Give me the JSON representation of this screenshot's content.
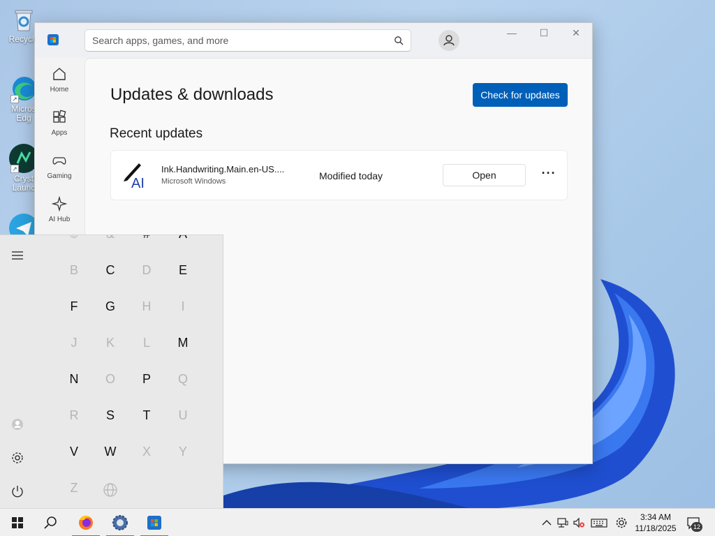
{
  "desktop": {
    "icons": [
      {
        "label": "Recycle",
        "icon": "recycle-bin-icon"
      },
      {
        "label": "Micros Edg",
        "icon": "edge-icon"
      },
      {
        "label": "Cryst Launc",
        "icon": "crystal-launcher-icon"
      },
      {
        "label": "",
        "icon": "telegram-icon"
      }
    ]
  },
  "store": {
    "search_placeholder": "Search apps, games, and more",
    "nav": [
      {
        "label": "Home",
        "icon": "home-icon"
      },
      {
        "label": "Apps",
        "icon": "apps-icon"
      },
      {
        "label": "Gaming",
        "icon": "gaming-icon"
      },
      {
        "label": "AI Hub",
        "icon": "ai-hub-icon"
      }
    ],
    "title": "Updates & downloads",
    "check_button": "Check for updates",
    "section_title": "Recent updates",
    "updates": [
      {
        "name": "Ink.Handwriting.Main.en-US....",
        "publisher": "Microsoft Windows",
        "status": "Modified today",
        "action": "Open",
        "icon_text": "AI"
      }
    ],
    "window_controls": {
      "minimize": "—",
      "maximize": "☐",
      "close": "✕"
    }
  },
  "start_menu": {
    "letters": [
      {
        "char": "&",
        "enabled": false
      },
      {
        "char": "#",
        "enabled": true
      },
      {
        "char": "A",
        "enabled": true
      },
      {
        "char": "B",
        "enabled": false
      },
      {
        "char": "C",
        "enabled": true
      },
      {
        "char": "D",
        "enabled": false
      },
      {
        "char": "E",
        "enabled": true
      },
      {
        "char": "F",
        "enabled": true
      },
      {
        "char": "G",
        "enabled": true
      },
      {
        "char": "H",
        "enabled": false
      },
      {
        "char": "I",
        "enabled": false
      },
      {
        "char": "J",
        "enabled": false
      },
      {
        "char": "K",
        "enabled": false
      },
      {
        "char": "L",
        "enabled": false
      },
      {
        "char": "M",
        "enabled": true
      },
      {
        "char": "N",
        "enabled": true
      },
      {
        "char": "O",
        "enabled": false
      },
      {
        "char": "P",
        "enabled": true
      },
      {
        "char": "Q",
        "enabled": false
      },
      {
        "char": "R",
        "enabled": false
      },
      {
        "char": "S",
        "enabled": true
      },
      {
        "char": "T",
        "enabled": true
      },
      {
        "char": "U",
        "enabled": false
      },
      {
        "char": "V",
        "enabled": true
      },
      {
        "char": "W",
        "enabled": true
      },
      {
        "char": "X",
        "enabled": false
      },
      {
        "char": "Y",
        "enabled": false
      },
      {
        "char": "Z",
        "enabled": false
      }
    ]
  },
  "taskbar": {
    "apps": [
      "start-icon",
      "search-icon",
      "firefox-icon",
      "settings-icon",
      "store-icon"
    ],
    "time": "3:34 AM",
    "date": "11/18/2025",
    "notification_count": "12"
  }
}
